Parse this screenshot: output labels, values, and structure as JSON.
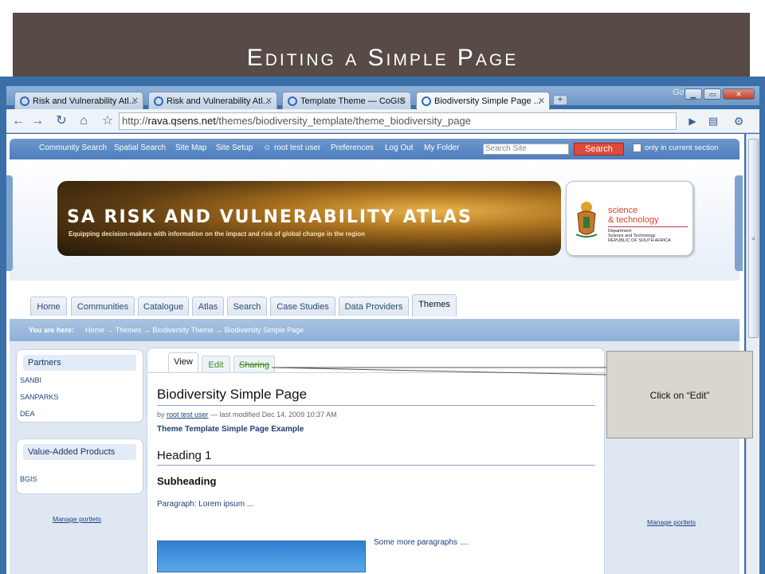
{
  "slide": {
    "title": "Editing a Simple Page"
  },
  "browser": {
    "google_label": "Google",
    "window_controls": [
      "▁",
      "▭",
      "✕"
    ],
    "tabs": [
      {
        "label": "Risk and Vulnerability Atl..."
      },
      {
        "label": "Risk and Vulnerability Atl..."
      },
      {
        "label": "Template Theme — CoGIS"
      },
      {
        "label": "Biodiversity Simple Page ..."
      }
    ],
    "new_tab": "+",
    "url_prefix": "http://",
    "url_host": "rava.qsens.net",
    "url_path": "/themes/biodiversity_template/theme_biodiversity_page"
  },
  "site": {
    "top_links": [
      "Community Search",
      "Spatial Search",
      "Site Map",
      "Site Setup",
      "root test user",
      "Preferences",
      "Log Out",
      "My Folder"
    ],
    "search_placeholder": "Search Site",
    "search_button": "Search",
    "scope_label": "only in current section",
    "banner_title": "SA Risk and Vulnerability Atlas",
    "banner_subtitle": "Equipping decision-makers with information on the impact and risk of global change in the region",
    "dst_line1": "science",
    "dst_line2": "& technology",
    "dst_dept": "Department:\nScience and Technology\nREPUBLIC OF SOUTH AFRICA",
    "nav_tabs": [
      "Home",
      "Communities",
      "Catalogue",
      "Atlas",
      "Search",
      "Case Studies",
      "Data Providers",
      "Themes"
    ],
    "breadcrumb_label": "You are here:",
    "breadcrumb_path": "Home → Themes → Biodiversity Theme → Biodiversity Simple Page"
  },
  "left": {
    "partners_title": "Partners",
    "partners": [
      "SANBI",
      "SANPARKS",
      "DEA"
    ],
    "products_title": "Value-Added Products",
    "products": [
      "BGIS"
    ],
    "manage": "Manage portlets"
  },
  "content": {
    "tabs": [
      "View",
      "Edit",
      "Sharing"
    ],
    "page_title": "Biodiversity Simple Page",
    "byline_prefix": "by ",
    "author": "root test user",
    "byline_suffix": " — last modified Dec 14, 2009 10:37 AM",
    "description": "Theme Template Simple Page Example",
    "heading1": "Heading 1",
    "subheading": "Subheading",
    "paragraph1": "Paragraph: Lorem ipsum ...",
    "paragraph2": "Some more paragraphs ...."
  },
  "right": {
    "manage": "Manage portlets"
  },
  "callout": {
    "text": "Click on “Edit”"
  }
}
